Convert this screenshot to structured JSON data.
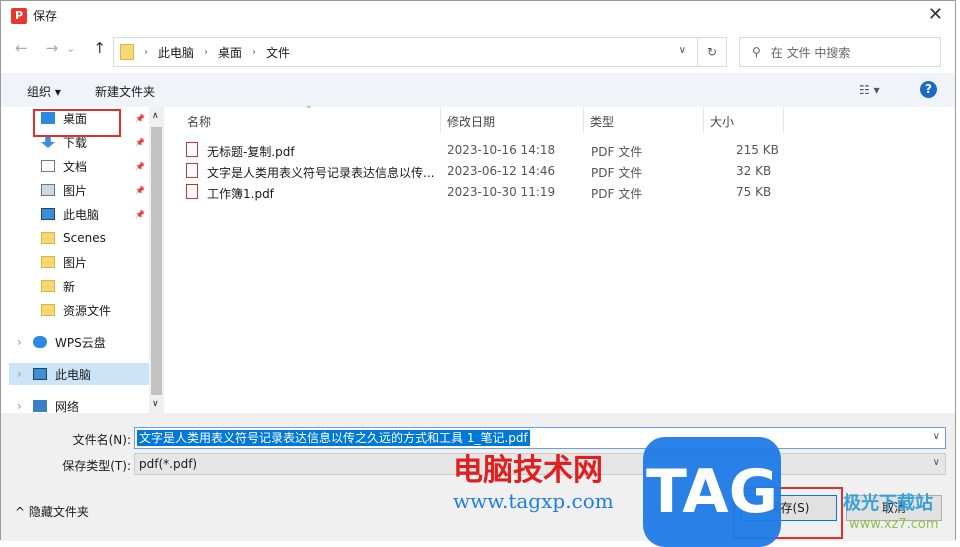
{
  "window": {
    "title": "保存",
    "close": "✕"
  },
  "nav": {
    "back": "←",
    "forward": "→",
    "recent": "⌄",
    "up": "↑",
    "breadcrumb": [
      "此电脑",
      "桌面",
      "文件"
    ],
    "refresh": "↻",
    "search_placeholder": "在 文件 中搜索"
  },
  "toolbar": {
    "organize": "组织 ▾",
    "new_folder": "新建文件夹",
    "view": "☷ ▾",
    "help": "?"
  },
  "sidebar": {
    "items": [
      {
        "label": "桌面",
        "icon": "desktop-icon",
        "pinned": true
      },
      {
        "label": "下载",
        "icon": "download-icon",
        "pinned": true
      },
      {
        "label": "文档",
        "icon": "document-icon",
        "pinned": true
      },
      {
        "label": "图片",
        "icon": "picture-icon",
        "pinned": true
      },
      {
        "label": "此电脑",
        "icon": "computer-icon",
        "pinned": true
      },
      {
        "label": "Scenes",
        "icon": "folder-icon"
      },
      {
        "label": "图片",
        "icon": "folder-icon"
      },
      {
        "label": "新",
        "icon": "folder-icon"
      },
      {
        "label": "资源文件",
        "icon": "folder-icon"
      },
      {
        "label": "WPS云盘",
        "icon": "cloud-icon"
      },
      {
        "label": "此电脑",
        "icon": "computer-icon",
        "selected": true
      },
      {
        "label": "网络",
        "icon": "network-icon"
      }
    ]
  },
  "columns": [
    "名称",
    "修改日期",
    "类型",
    "大小"
  ],
  "files": [
    {
      "name": "无标题-复制.pdf",
      "date": "2023-10-16 14:18",
      "type": "PDF 文件",
      "size": "215 KB"
    },
    {
      "name": "文字是人类用表义符号记录表达信息以传...",
      "date": "2023-06-12 14:46",
      "type": "PDF 文件",
      "size": "32 KB"
    },
    {
      "name": "工作簿1.pdf",
      "date": "2023-10-30 11:19",
      "type": "PDF 文件",
      "size": "75 KB"
    }
  ],
  "form": {
    "filename_label": "文件名(N):",
    "filename": "文字是人类用表义符号记录表达信息以传之久远的方式和工具 1_笔记.pdf",
    "type_label": "保存类型(T):",
    "type": "pdf(*.pdf)",
    "hide_folders": "^ 隐藏文件夹",
    "save": "保存(S)",
    "cancel": "取消"
  },
  "watermark": {
    "site_name": "电脑技术网",
    "url": "www.tagxp.com",
    "logo": "TAG",
    "brand2": "极光下载站",
    "url2": "www.xz7.com"
  },
  "colors": {
    "accent": "#0078d7",
    "highlight_box": "#e0302a"
  }
}
